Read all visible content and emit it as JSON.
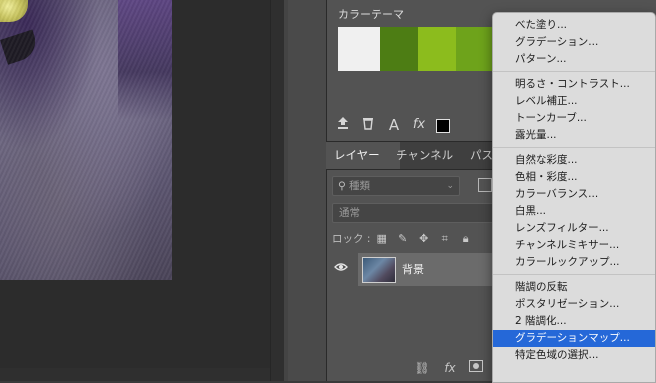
{
  "swatches": {
    "title": "カラーテーマ",
    "colors": [
      "#f0f0f0",
      "#4d7d14",
      "#8cbc1d",
      "#6ea31b"
    ]
  },
  "swatch_toolbar": {
    "icons": [
      "upload-icon",
      "trash-icon",
      "text-icon",
      "fx-icon"
    ],
    "text_icon": "A",
    "fx_icon": "fx"
  },
  "tabs": [
    "レイヤー",
    "チャンネル",
    "パス"
  ],
  "layers": {
    "search_placeholder": "種類",
    "blend_mode": "通常",
    "lock_label": "ロック :",
    "layer_name": "背景"
  },
  "menu": {
    "groups": [
      [
        "べた塗り...",
        "グラデーション...",
        "パターン..."
      ],
      [
        "明るさ・コントラスト...",
        "レベル補正...",
        "トーンカーブ...",
        "露光量..."
      ],
      [
        "自然な彩度...",
        "色相・彩度...",
        "カラーバランス...",
        "白黒...",
        "レンズフィルター...",
        "チャンネルミキサー...",
        "カラールックアップ..."
      ],
      [
        "階調の反転",
        "ポスタリゼーション...",
        "2 階調化...",
        "グラデーションマップ...",
        "特定色域の選択..."
      ]
    ],
    "highlighted": "グラデーションマップ...",
    "highlight_color": "#2568d8"
  }
}
